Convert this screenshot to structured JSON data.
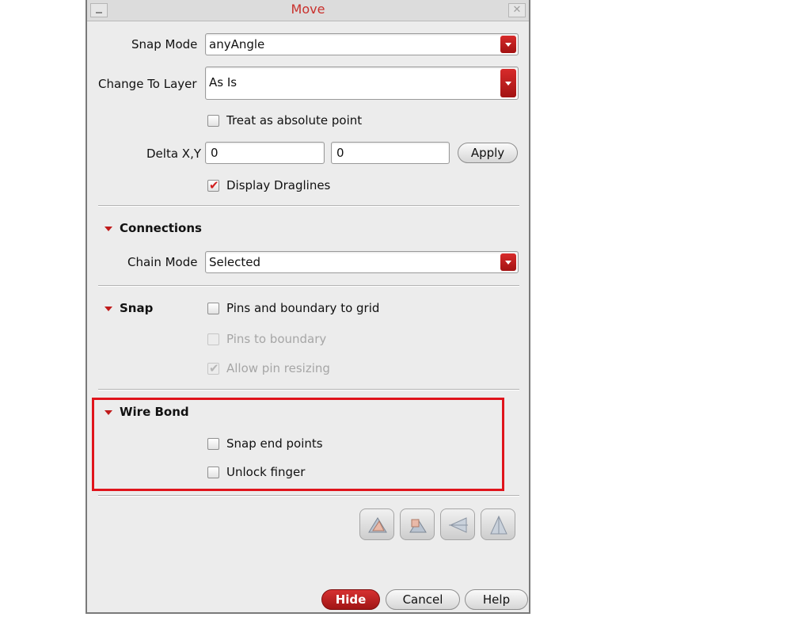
{
  "dialog": {
    "title": "Move",
    "close_glyph": "✕",
    "snap_mode": {
      "label": "Snap Mode",
      "value": "anyAngle"
    },
    "change_layer": {
      "label": "Change To Layer",
      "value": "As Is"
    },
    "treat_absolute": {
      "label": "Treat as absolute point",
      "checked": false
    },
    "delta": {
      "label": "Delta X,Y",
      "x_value": "0",
      "y_value": "0",
      "apply_label": "Apply"
    },
    "display_draglines": {
      "label": "Display Draglines",
      "checked": true
    }
  },
  "connections": {
    "title": "Connections",
    "chain_mode": {
      "label": "Chain Mode",
      "value": "Selected"
    }
  },
  "snap": {
    "title": "Snap",
    "pins_boundary_grid": {
      "label": "Pins and boundary to grid",
      "checked": false,
      "enabled": true
    },
    "pins_to_boundary": {
      "label": "Pins to boundary",
      "checked": false,
      "enabled": false
    },
    "allow_pin_resizing": {
      "label": "Allow pin resizing",
      "checked": true,
      "enabled": false
    }
  },
  "wire_bond": {
    "title": "Wire Bond",
    "snap_end_points": {
      "label": "Snap end points",
      "checked": false
    },
    "unlock_finger": {
      "label": "Unlock finger",
      "checked": false
    }
  },
  "tool_buttons": [
    "rotate-icon",
    "flip-icon",
    "mirror-left-icon",
    "mirror-vertical-icon"
  ],
  "footer": {
    "hide": {
      "label": "Hide",
      "mnemonic": "H"
    },
    "cancel": {
      "label": "Cancel",
      "mnemonic": "C"
    },
    "help": {
      "label": "Help",
      "mnemonic": "H"
    }
  },
  "colors": {
    "accent": "#c9302c",
    "highlight": "#e0141c",
    "background": "#ececec"
  }
}
